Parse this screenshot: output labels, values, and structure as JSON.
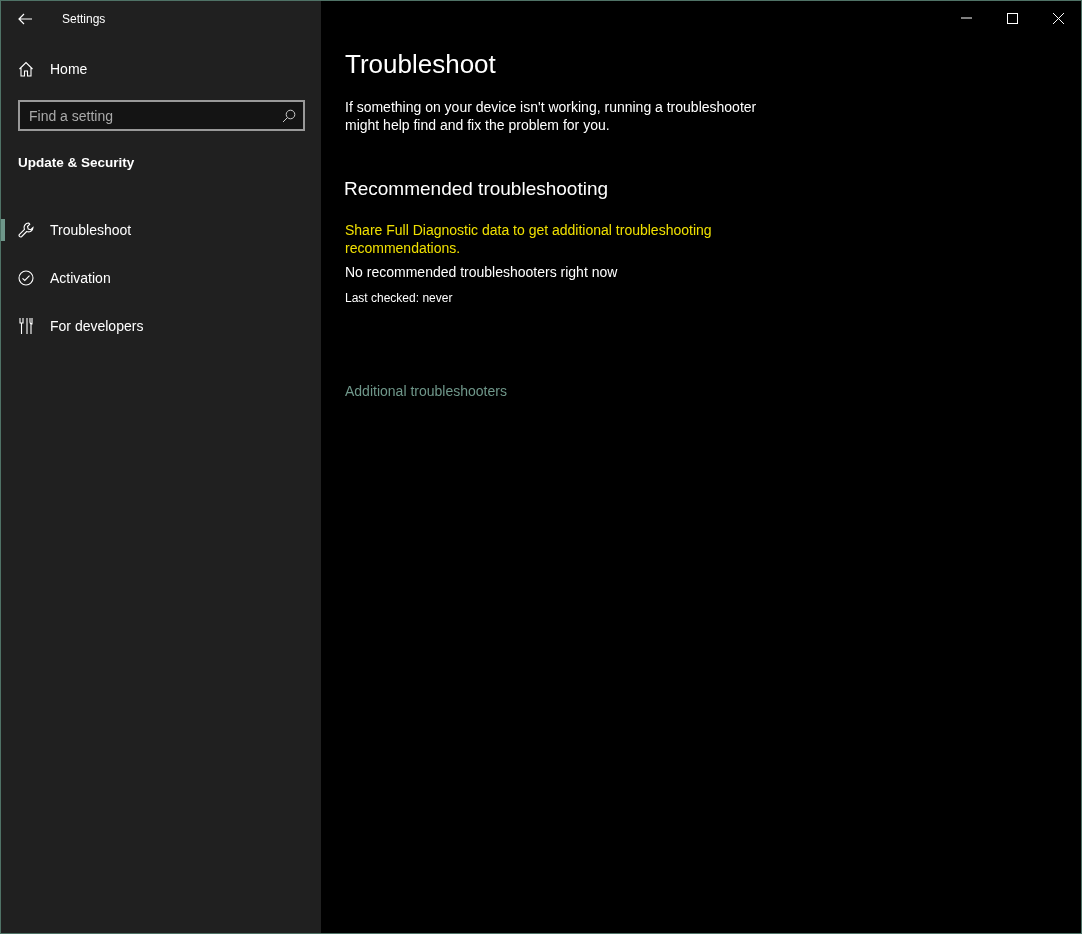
{
  "window": {
    "title": "Settings"
  },
  "sidebar": {
    "home": "Home",
    "search": {
      "placeholder": "Find a setting"
    },
    "section": "Update & Security",
    "items": [
      {
        "label": "Troubleshoot",
        "selected": true
      },
      {
        "label": "Activation",
        "selected": false
      },
      {
        "label": "For developers",
        "selected": false
      }
    ]
  },
  "main": {
    "title": "Troubleshoot",
    "intro": "If something on your device isn't working, running a troubleshooter might help find and fix the problem for you.",
    "recommended": {
      "heading": "Recommended troubleshooting",
      "warning": "Share Full Diagnostic data to get additional troubleshooting recommendations.",
      "status": "No recommended troubleshooters right now",
      "last_checked": "Last checked: never"
    },
    "link": "Additional troubleshooters"
  }
}
